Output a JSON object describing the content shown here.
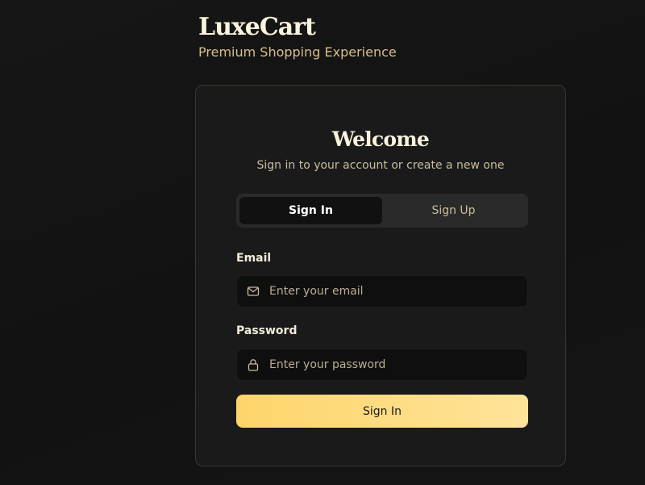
{
  "brand": {
    "title": "LuxeCart",
    "subtitle": "Premium Shopping Experience"
  },
  "card": {
    "title": "Welcome",
    "subtitle": "Sign in to your account or create a new one"
  },
  "tabs": [
    {
      "label": "Sign In",
      "active": true
    },
    {
      "label": "Sign Up",
      "active": false
    }
  ],
  "form": {
    "email": {
      "label": "Email",
      "placeholder": "Enter your email",
      "value": "",
      "icon": "mail-icon"
    },
    "password": {
      "label": "Password",
      "placeholder": "Enter your password",
      "value": "",
      "icon": "lock-icon"
    },
    "submit_label": "Sign In"
  },
  "colors": {
    "background": "#141414",
    "card": "#1a1a1a",
    "accent_start": "#fed56b",
    "accent_end": "#fee399",
    "brand_subtitle": "#d8bf88"
  }
}
